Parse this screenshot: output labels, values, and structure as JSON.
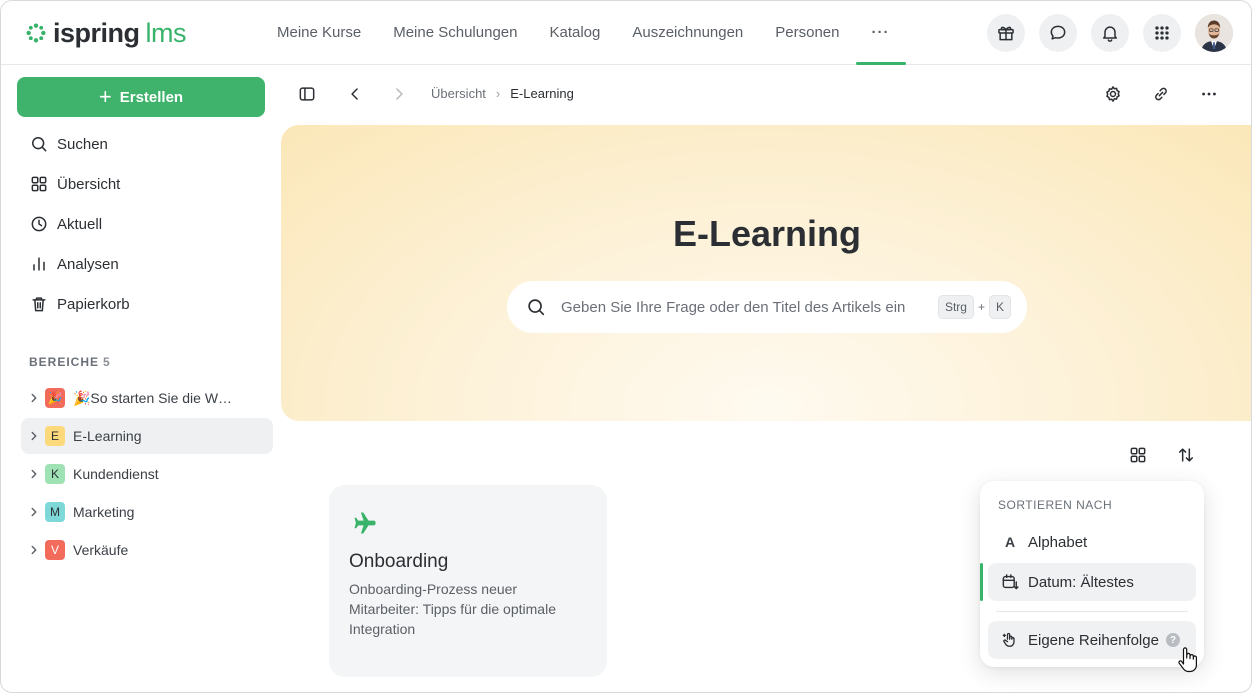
{
  "brand": {
    "name": "ispring",
    "suffix": "lms",
    "accent": "#39b36a"
  },
  "nav": {
    "items": [
      {
        "label": "Meine Kurse"
      },
      {
        "label": "Meine Schulungen"
      },
      {
        "label": "Katalog"
      },
      {
        "label": "Auszeichnungen"
      },
      {
        "label": "Personen"
      }
    ],
    "more_label": "···"
  },
  "top_icons": [
    "gift-icon",
    "chat-icon",
    "bell-icon",
    "apps-grid-icon"
  ],
  "sidebar": {
    "create_label": "Erstellen",
    "menu": [
      {
        "label": "Suchen",
        "icon": "search-icon"
      },
      {
        "label": "Übersicht",
        "icon": "grid-icon"
      },
      {
        "label": "Aktuell",
        "icon": "clock-icon"
      },
      {
        "label": "Analysen",
        "icon": "bar-chart-icon"
      },
      {
        "label": "Papierkorb",
        "icon": "trash-icon"
      }
    ],
    "section_title": "BEREICHE",
    "section_count": "5",
    "spaces": [
      {
        "badge": "🎉",
        "label": "🎉So starten Sie die W…",
        "color": "#f26b5b"
      },
      {
        "badge": "E",
        "label": "E-Learning",
        "color": "#fcd97a"
      },
      {
        "badge": "K",
        "label": "Kundendienst",
        "color": "#9fe3b5"
      },
      {
        "badge": "M",
        "label": "Marketing",
        "color": "#7fd8d8"
      },
      {
        "badge": "V",
        "label": "Verkäufe",
        "color": "#f26b5b"
      }
    ]
  },
  "breadcrumb": {
    "parent": "Übersicht",
    "current": "E-Learning"
  },
  "hero": {
    "title": "E-Learning",
    "search_placeholder": "Geben Sie Ihre Frage oder den Titel des Artikels ein",
    "shortcut_key1": "Strg",
    "shortcut_plus": "+",
    "shortcut_key2": "K"
  },
  "card": {
    "icon": "airplane-icon",
    "title": "Onboarding",
    "description": "Onboarding-Prozess neuer Mitarbeiter: Tipps für die optimale Integration"
  },
  "sort_menu": {
    "title": "SORTIEREN NACH",
    "options": [
      {
        "label": "Alphabet",
        "icon": "A"
      },
      {
        "label": "Datum: Ältestes",
        "icon": "calendar-sort-icon"
      },
      {
        "label": "Eigene Reihenfolge",
        "icon": "drag-hand-icon"
      }
    ],
    "help_glyph": "?"
  }
}
